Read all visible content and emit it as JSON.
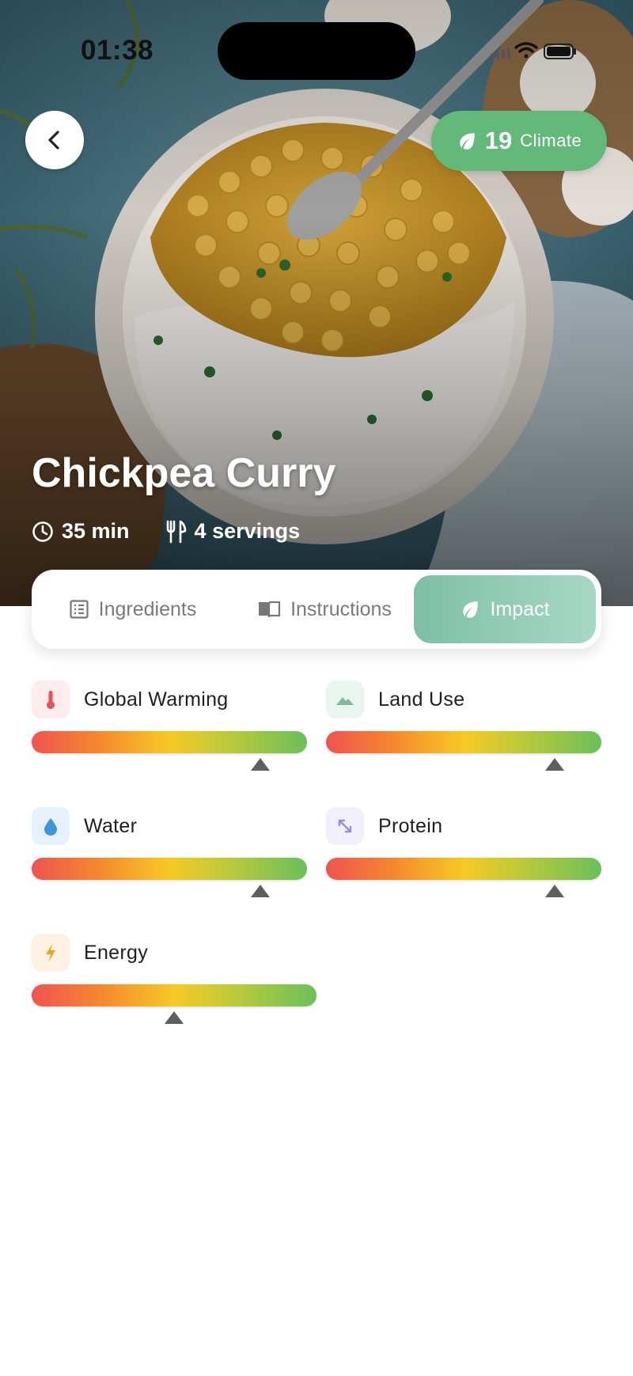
{
  "status_bar": {
    "time": "01:38"
  },
  "header": {
    "climate_score": "19",
    "climate_label": "Climate"
  },
  "recipe": {
    "title": "Chickpea Curry",
    "time": "35 min",
    "servings": "4 servings"
  },
  "tabs": [
    {
      "label": "Ingredients",
      "icon": "list-icon",
      "active": false
    },
    {
      "label": "Instructions",
      "icon": "book-icon",
      "active": false
    },
    {
      "label": "Impact",
      "icon": "leaf-icon",
      "active": true
    }
  ],
  "metrics": [
    {
      "label": "Global Warming",
      "icon": "thermometer-icon",
      "icon_color": "#e8525a",
      "icon_bg": "#fdecec",
      "level": 0.83
    },
    {
      "label": "Land Use",
      "icon": "mountain-icon",
      "icon_color": "#7fb8a3",
      "icon_bg": "#eaf5f0",
      "level": 0.83
    },
    {
      "label": "Water",
      "icon": "droplet-icon",
      "icon_color": "#3f96d6",
      "icon_bg": "#e6f1fb",
      "level": 0.83
    },
    {
      "label": "Protein",
      "icon": "arrows-icon",
      "icon_color": "#9b8fd1",
      "icon_bg": "#f1eff9",
      "level": 0.83
    },
    {
      "label": "Energy",
      "icon": "bolt-icon",
      "icon_color": "#f2a41f",
      "icon_bg": "#fdf2e2",
      "level": 0.5
    }
  ],
  "colors": {
    "accent": "#62b979",
    "impact_tab": "#7dbfa5",
    "bar_low": "#ef5350",
    "bar_mid": "#f7c926",
    "bar_high": "#6cbf5b"
  }
}
